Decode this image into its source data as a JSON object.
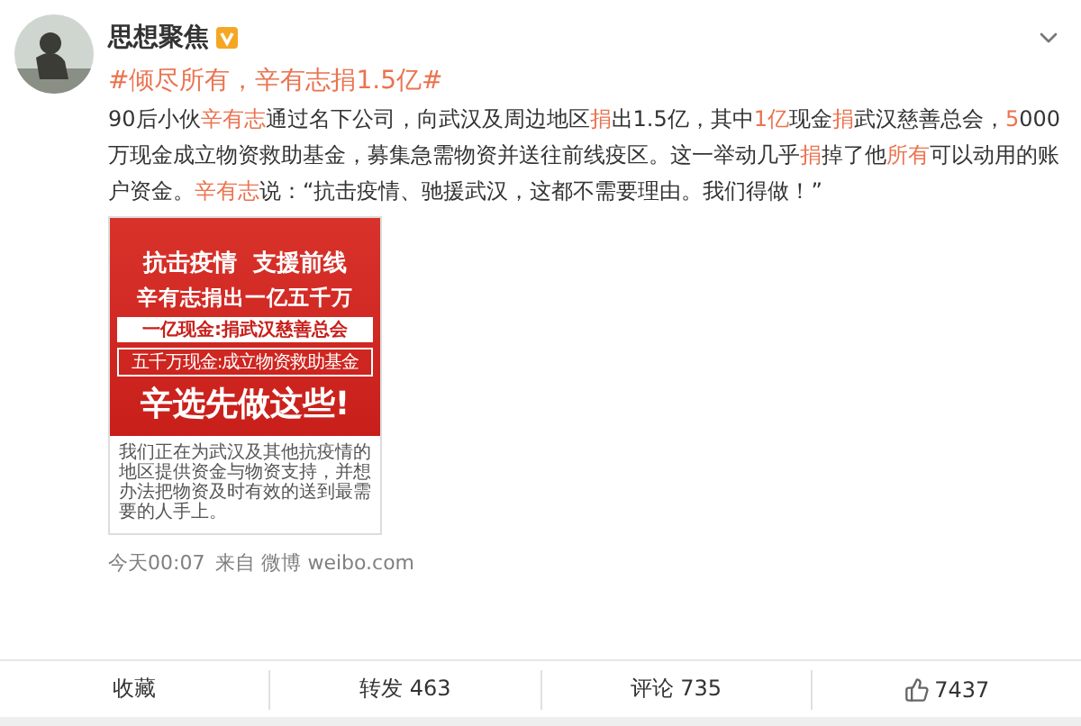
{
  "post": {
    "author": "思想聚焦",
    "verified": true,
    "hashtag": "#倾尽所有，辛有志捐1.5亿#",
    "body": [
      {
        "text": "90后小伙",
        "highlight": false
      },
      {
        "text": "辛有志",
        "highlight": true
      },
      {
        "text": "通过名下公司，向武汉及周边地区",
        "highlight": false
      },
      {
        "text": "捐",
        "highlight": true
      },
      {
        "text": "出1.5亿，其中",
        "highlight": false
      },
      {
        "text": "1亿",
        "highlight": true
      },
      {
        "text": "现金",
        "highlight": false
      },
      {
        "text": "捐",
        "highlight": true
      },
      {
        "text": "武汉慈善总会，",
        "highlight": false
      },
      {
        "text": "5",
        "highlight": true
      },
      {
        "text": "000万现金成立物资救助基金，募集急需物资并送往前线疫区。这一举动几乎",
        "highlight": false
      },
      {
        "text": "捐",
        "highlight": true
      },
      {
        "text": "掉了他",
        "highlight": false
      },
      {
        "text": "所有",
        "highlight": true
      },
      {
        "text": "可以动用的账户资金。",
        "highlight": false
      },
      {
        "text": "辛有志",
        "highlight": true
      },
      {
        "text": "说：“抗击疫情、驰援武汉，这都不需要理由。我们得做！”",
        "highlight": false
      }
    ],
    "poster": {
      "headline": "抗击疫情  支援前线",
      "subline": "辛有志捐出一亿五千万",
      "band_1": "一亿现金:捐武汉慈善总会",
      "band_2": "五千万现金:成立物资救助基金",
      "slogan": "辛选先做这些!",
      "note": "我们正在为武汉及其他抗疫情的地区提供资金与物资支持，并想办法把物资及时有效的送到最需要的人手上。"
    },
    "time": "今天00:07",
    "source": "来自 微博 weibo.com"
  },
  "actions": [
    {
      "kind": "text",
      "label": "收藏"
    },
    {
      "kind": "text",
      "label": "转发 463"
    },
    {
      "kind": "text",
      "label": "评论 735"
    },
    {
      "kind": "like",
      "label": "7437"
    }
  ]
}
